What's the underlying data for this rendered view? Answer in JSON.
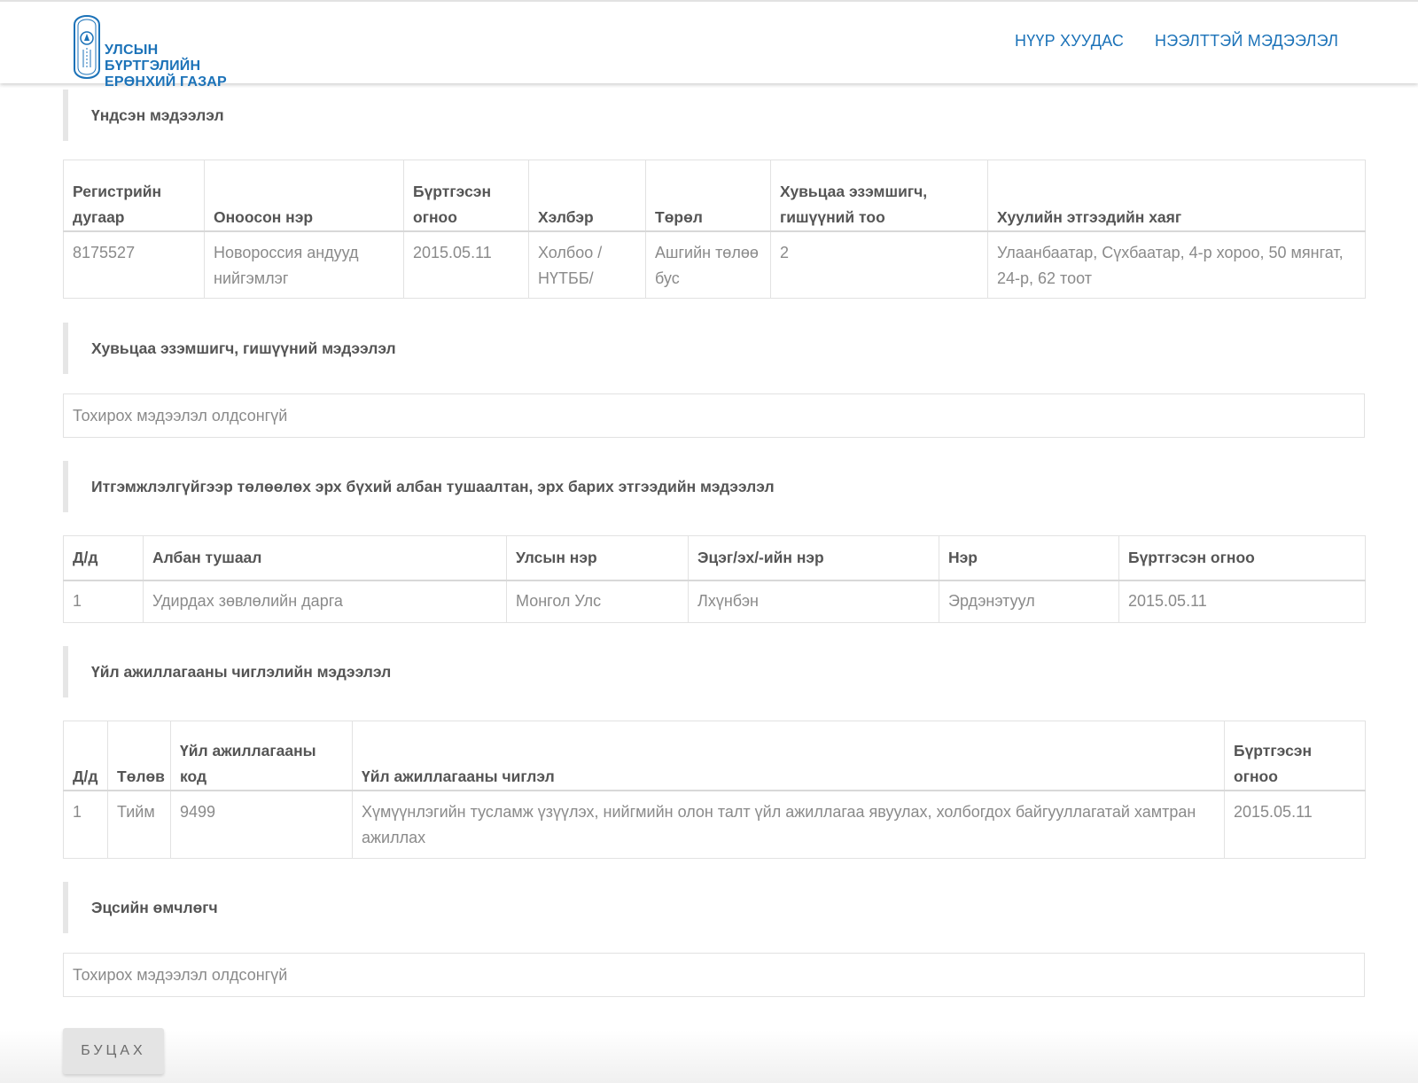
{
  "header": {
    "logo_line1": "УЛСЫН БҮРТГЭЛИЙН",
    "logo_line2": "ЕРӨНХИЙ ГАЗАР",
    "nav": {
      "home": "НҮҮР ХУУДАС",
      "public_info": "НЭЭЛТТЭЙ МЭДЭЭЛЭЛ"
    },
    "brand_color": "#1b72b8"
  },
  "basic_info": {
    "title": "Үндсэн мэдээлэл",
    "headers": [
      "Регистрийн дугаар",
      "Оноосон нэр",
      "Бүртгэсэн огноо",
      "Хэлбэр",
      "Төрөл",
      "Хувьцаа эзэмшигч, гишүүний тоо",
      "Хуулийн этгээдийн хаяг"
    ],
    "row": [
      "8175527",
      "Новороссия андууд нийгэмлэг",
      "2015.05.11",
      "Холбоо / НҮТББ/",
      "Ашгийн төлөө бус",
      "2",
      "Улаанбаатар, Сүхбаатар, 4-р хороо, 50 мянгат, 24-р, 62 тоот"
    ]
  },
  "shareholders": {
    "title": "Хувьцаа эзэмшигч, гишүүний мэдээлэл",
    "empty": "Тохирох мэдээлэл олдсонгүй"
  },
  "officials": {
    "title": "Итгэмжлэлгүйгээр төлөөлөх эрх бүхий албан тушаалтан, эрх барих этгээдийн мэдээлэл",
    "headers": [
      "Д/д",
      "Албан тушаал",
      "Улсын нэр",
      "Эцэг/эх/-ийн нэр",
      "Нэр",
      "Бүртгэсэн огноо"
    ],
    "rows": [
      [
        "1",
        "Удирдах зөвлөлийн дарга",
        "Монгол Улс",
        "Лхүнбэн",
        "Эрдэнэтуул",
        "2015.05.11"
      ]
    ]
  },
  "activities": {
    "title": "Үйл ажиллагааны чиглэлийн мэдээлэл",
    "headers": [
      "Д/д",
      "Төлөв",
      "Үйл ажиллагааны код",
      "Үйл ажиллагааны чиглэл",
      "Бүртгэсэн огноо"
    ],
    "rows": [
      [
        "1",
        "Тийм",
        "9499",
        "Хүмүүнлэгийн тусламж үзүүлэх, нийгмийн олон талт үйл ажиллагаа явуулах, холбогдох байгууллагатай хамтран ажиллах",
        "2015.05.11"
      ]
    ]
  },
  "beneficial_owner": {
    "title": "Эцсийн өмчлөгч",
    "empty": "Тохирох мэдээлэл олдсонгүй"
  },
  "back_button": "БУЦАХ"
}
